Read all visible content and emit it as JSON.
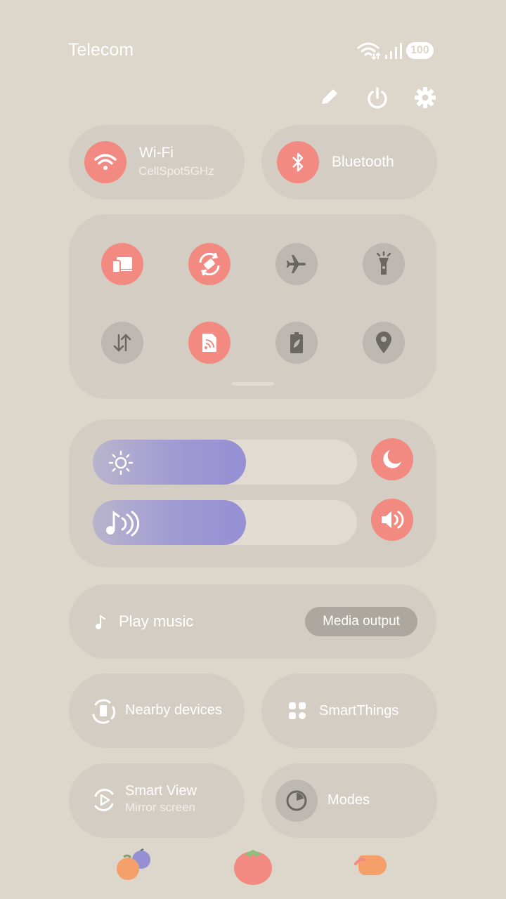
{
  "status_bar": {
    "carrier": "Telecom",
    "battery": "100",
    "wifi_icon": "wifi-arrows-icon",
    "signal_icon": "signal-bars-icon"
  },
  "top_actions": [
    "pencil-icon",
    "power-icon",
    "gear-icon"
  ],
  "wifi_tile": {
    "title": "Wi-Fi",
    "subtitle": "CellSpot5GHz",
    "active": true
  },
  "bluetooth_tile": {
    "title": "Bluetooth",
    "active": true
  },
  "quick_toggles": [
    {
      "icon": "screen-share-icon",
      "active": true
    },
    {
      "icon": "auto-rotate-icon",
      "active": true
    },
    {
      "icon": "airplane-icon",
      "active": false
    },
    {
      "icon": "flashlight-icon",
      "active": false
    },
    {
      "icon": "mobile-data-icon",
      "active": false
    },
    {
      "icon": "nfc-icon",
      "active": true
    },
    {
      "icon": "power-saving-icon",
      "active": false
    },
    {
      "icon": "location-icon",
      "active": false
    }
  ],
  "brightness": {
    "level": 0.58,
    "icon": "sun-icon",
    "night_mode_icon": "moon-icon"
  },
  "volume": {
    "level": 0.58,
    "icon": "music-note-waves-icon",
    "sound_icon": "speaker-icon"
  },
  "media": {
    "label": "Play music",
    "output_label": "Media output"
  },
  "nearby": {
    "label": "Nearby devices"
  },
  "smartthings": {
    "label": "SmartThings"
  },
  "smartview": {
    "title": "Smart View",
    "subtitle": "Mirror screen"
  },
  "modes": {
    "label": "Modes"
  },
  "colors": {
    "background": "#ddd6ca",
    "card": "#d3cdc3",
    "accent": "#f28a82",
    "inactive": "#bdb8b1",
    "slider": "#958fd4"
  }
}
